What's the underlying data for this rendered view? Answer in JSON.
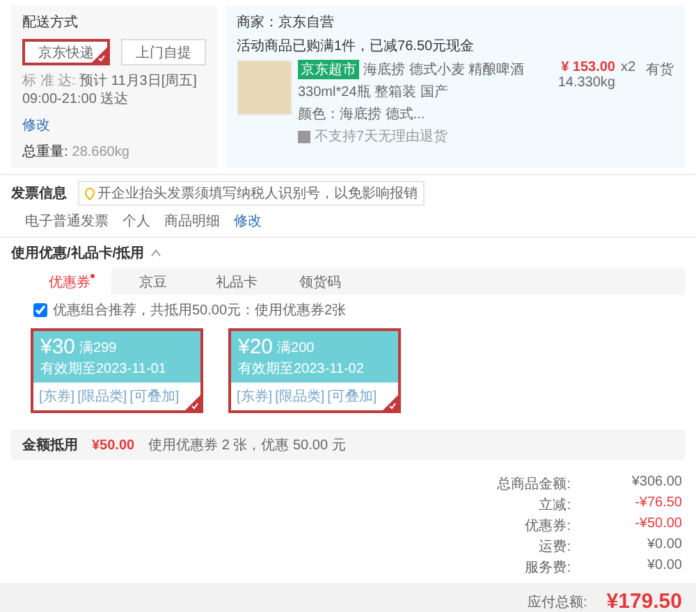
{
  "delivery": {
    "title": "配送方式",
    "options": [
      {
        "label": "京东快递",
        "selected": true
      },
      {
        "label": "上门自提",
        "selected": false
      }
    ],
    "standard_label": "标 准 达:",
    "standard_text": "预计 11月3日[周五] 09:00-21:00 送达",
    "edit_link": "修改",
    "weight_label": "总重量:",
    "weight": "28.660kg"
  },
  "merchant": {
    "label": "商家：京东自营",
    "promo": "活动商品已购满1件，已减76.50元现金",
    "product": {
      "badge": "京东超市",
      "name_lines": [
        "海底捞 德式小麦 精酿啤酒",
        "330ml*24瓶 整箱装 国产"
      ],
      "color_text": "颜色：海底捞 德式...",
      "notice": "不支持7天无理由退货",
      "price": "¥ 153.00",
      "weight": "14.330kg",
      "qty": "x2",
      "stock": "有货"
    }
  },
  "invoice": {
    "title": "发票信息",
    "tip": "开企业抬头发票须填写纳税人识别号，以免影响报销",
    "type": "电子普通发票",
    "title_type": "个人",
    "content": "商品明细",
    "edit_link": "修改"
  },
  "discount": {
    "title": "使用优惠/礼品卡/抵用",
    "expanded": true,
    "tabs": [
      {
        "label": "优惠券",
        "selected": true,
        "marked": true
      },
      {
        "label": "京豆",
        "selected": false,
        "marked": false
      },
      {
        "label": "礼品卡",
        "selected": false,
        "marked": false
      },
      {
        "label": "领货码",
        "selected": false,
        "marked": false
      }
    ],
    "auto": {
      "checked": true,
      "label": "优惠组合推荐，共抵用50.00元：使用优惠券2张"
    },
    "coupons": [
      {
        "amount": "¥30",
        "threshold": "满299",
        "expiry": "有效期至2023-11-01",
        "tags": [
          "[东券]",
          "[限品类]",
          "[可叠加]"
        ],
        "selected": true
      },
      {
        "amount": "¥20",
        "threshold": "满200",
        "expiry": "有效期至2023-11-02",
        "tags": [
          "[东券]",
          "[限品类]",
          "[可叠加]"
        ],
        "selected": true
      }
    ],
    "summary_label": "金额抵用",
    "summary_amount": "¥50.00",
    "summary_text": "使用优惠券 2 张，优惠 50.00 元"
  },
  "totals": {
    "rows": [
      {
        "label": "总商品金额:",
        "value": "¥306.00",
        "kind": "plain"
      },
      {
        "label": "立减:",
        "value": "-¥76.50",
        "kind": "discount"
      },
      {
        "label": "优惠券:",
        "value": "-¥50.00",
        "kind": "discount"
      },
      {
        "label": "运费:",
        "value": "¥0.00",
        "kind": "plain"
      },
      {
        "label": "服务费:",
        "value": "¥0.00",
        "kind": "plain"
      }
    ],
    "payable_label": "应付总额:",
    "payable": "¥179.50"
  }
}
